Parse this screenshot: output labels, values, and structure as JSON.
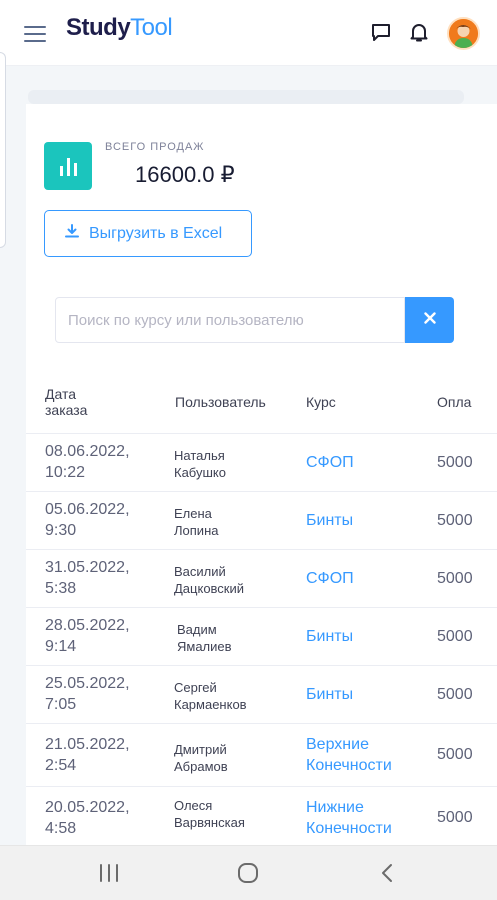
{
  "app": {
    "logo_part1": "Study",
    "logo_part2": "Tool"
  },
  "header": {
    "icons": [
      "menu-icon",
      "chat-icon",
      "bell-icon",
      "avatar"
    ]
  },
  "stats": {
    "label": "ВСЕГО ПРОДАЖ",
    "value": "16600.0 ₽"
  },
  "export_button": {
    "label": "Выгрузить в Excel"
  },
  "search": {
    "placeholder": "Поиск по курсу или пользователю",
    "value": ""
  },
  "table": {
    "headers": {
      "date_line1": "Дата",
      "date_line2": "заказа",
      "user": "Пользователь",
      "course": "Курс",
      "payment": "Опла"
    },
    "rows": [
      {
        "date1": "08.06.2022,",
        "date2": "10:22",
        "user1": "Наталья",
        "user2": "Кабушко",
        "course1": "СФОП",
        "course2": "",
        "pay": "5000"
      },
      {
        "date1": "05.06.2022,",
        "date2": "9:30",
        "user1": "Елена",
        "user2": "Лопина",
        "course1": "Бинты",
        "course2": "",
        "pay": "5000"
      },
      {
        "date1": "31.05.2022,",
        "date2": "5:38",
        "user1": "Василий",
        "user2": "Дацковский",
        "course1": "СФОП",
        "course2": "",
        "pay": "5000"
      },
      {
        "date1": "28.05.2022,",
        "date2": "9:14",
        "user1": "Вадим",
        "user2": "Ямалиев",
        "course1": "Бинты",
        "course2": "",
        "pay": "5000"
      },
      {
        "date1": "25.05.2022,",
        "date2": "7:05",
        "user1": "Сергей",
        "user2": "Кармаенков",
        "course1": "Бинты",
        "course2": "",
        "pay": "5000"
      },
      {
        "date1": "21.05.2022,",
        "date2": "2:54",
        "user1": "Дмитрий",
        "user2": "Абрамов",
        "course1": "Верхние",
        "course2": "Конечности",
        "pay": "5000"
      },
      {
        "date1": "20.05.2022,",
        "date2": "4:58",
        "user1": "Олеся",
        "user2": "Варвянская",
        "course1": "Нижние",
        "course2": "Конечности",
        "pay": "5000"
      }
    ]
  },
  "colors": {
    "accent": "#3699ff",
    "teal": "#1bc5bd",
    "brand_dark": "#1e1e4b"
  },
  "navbar": {
    "icons": [
      "recent-apps-icon",
      "home-icon",
      "back-icon"
    ]
  }
}
